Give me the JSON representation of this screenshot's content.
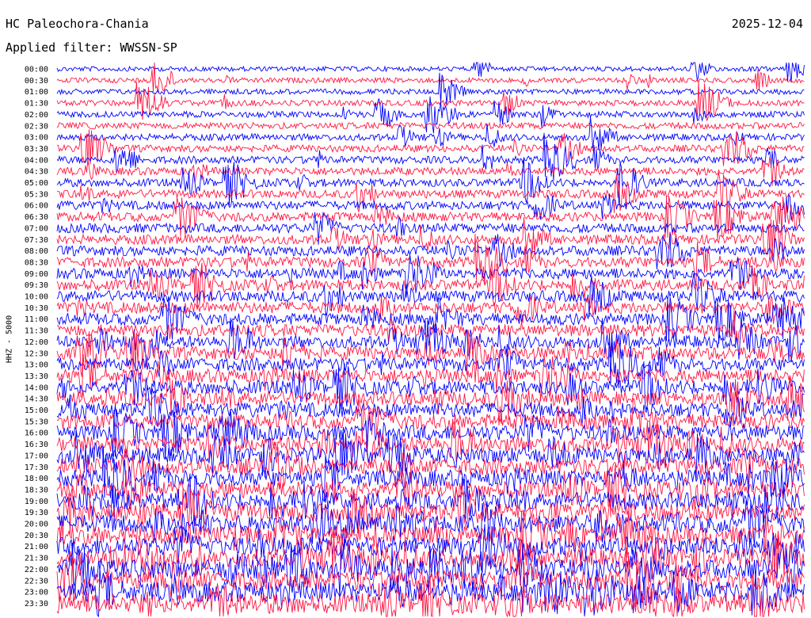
{
  "header": {
    "station": "HC Paleochora-Chania",
    "date": "2025-12-04",
    "filter": "Applied filter: WWSSN-SP"
  },
  "chart_data": {
    "type": "line",
    "title": "HC Paleochora-Chania",
    "ylabel": "HHZ - 5000",
    "rows": [
      "00:00",
      "00:30",
      "01:00",
      "01:30",
      "02:00",
      "02:30",
      "03:00",
      "03:30",
      "04:00",
      "04:30",
      "05:00",
      "05:30",
      "06:00",
      "06:30",
      "07:00",
      "07:30",
      "08:00",
      "08:30",
      "09:00",
      "09:30",
      "10:00",
      "10:30",
      "11:00",
      "11:30",
      "12:00",
      "12:30",
      "13:00",
      "13:30",
      "14:00",
      "14:30",
      "15:00",
      "15:30",
      "16:00",
      "16:30",
      "17:00",
      "17:30",
      "18:00",
      "18:30",
      "19:00",
      "19:30",
      "20:00",
      "20:30",
      "21:00",
      "21:30",
      "22:00",
      "22:30",
      "23:00",
      "23:30"
    ],
    "series_colors": [
      "#0000ff",
      "#ff1744"
    ]
  }
}
